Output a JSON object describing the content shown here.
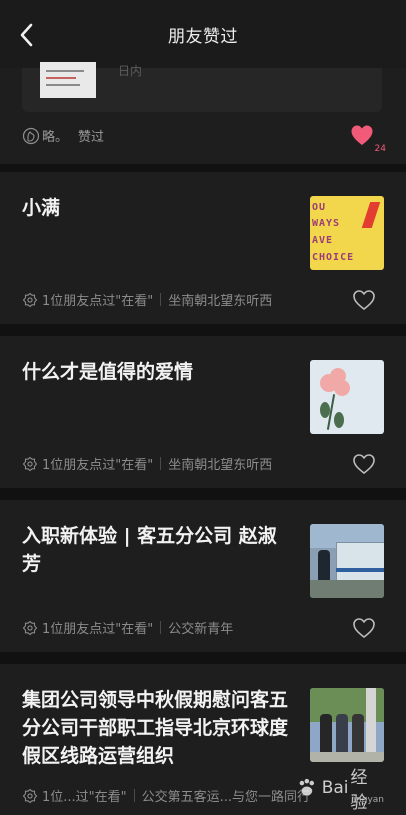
{
  "header": {
    "title": "朋友赞过",
    "back_icon": "back-chevron-icon"
  },
  "top_card": {
    "snippet": "日内",
    "friend": "略。",
    "action": "赞过",
    "like_count": "24",
    "like_color": "#f25a7a"
  },
  "articles": [
    {
      "title": "小满",
      "thumbnail": "you-always-have-choice",
      "meta_label": "1位朋友点过\"在看\"",
      "source": "坐南朝北望东听西"
    },
    {
      "title": "什么才是值得的爱情",
      "thumbnail": "rose-flower",
      "meta_label": "1位朋友点过\"在看\"",
      "source": "坐南朝北望东听西"
    },
    {
      "title": "入职新体验 | 客五分公司 赵淑芳",
      "thumbnail": "bus-portrait",
      "meta_label": "1位朋友点过\"在看\"",
      "source": "公交新青年"
    },
    {
      "title": "集团公司领导中秋假期慰问客五分公司干部职工指导北京环球度假区线路运营组织",
      "thumbnail": "meeting-photo",
      "meta_label": "1位...过\"在看\"",
      "source": "公交第五客运...与您一路同行"
    }
  ],
  "choice_thumb_lines": [
    "OU",
    "WAYS",
    "AVE",
    "CHOICE"
  ],
  "watermark": {
    "main": "Bai",
    "suffix": "经验",
    "sub": "jingyan"
  },
  "colors": {
    "background": "#111111",
    "card": "#1e1e1e",
    "text": "#f2f2f2",
    "muted": "#8c8c8c",
    "accent": "#f25a7a"
  }
}
